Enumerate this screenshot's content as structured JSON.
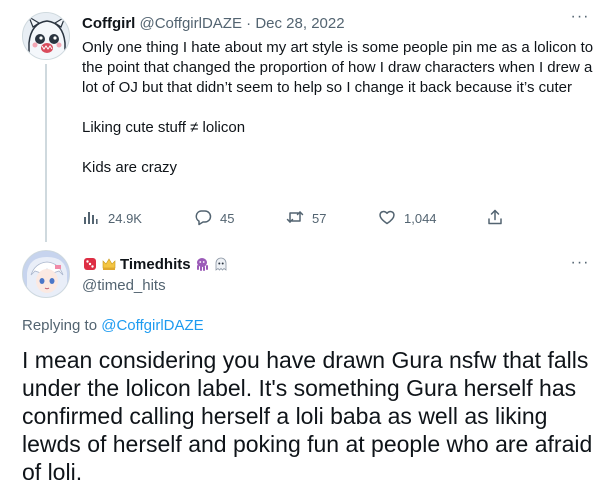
{
  "tweet": {
    "author_name": "Coffgirl",
    "author_handle": "@CoffgirlDAZE",
    "separator": " · ",
    "date": "Dec 28, 2022",
    "more_label": "···",
    "paragraphs": [
      "Only one thing I hate about my art style is some people pin me as a lolicon to the point that changed the proportion of how I draw characters when I drew a lot of OJ but that didn’t seem to help so I change it back because it’s cuter",
      "Liking cute stuff ≠ lolicon",
      "Kids are crazy"
    ],
    "metrics": {
      "views": "24.9K",
      "replies": "45",
      "retweets": "57",
      "likes": "1,044"
    },
    "icons": [
      "analytics-icon",
      "reply-icon",
      "retweet-icon",
      "like-icon",
      "share-icon"
    ]
  },
  "reply": {
    "author_name": "Timedhits",
    "author_handle": "@timed_hits",
    "name_emojis": [
      "dice-icon",
      "crown-icon",
      "octopus-icon",
      "ghost-icon"
    ],
    "more_label": "···",
    "replying_prefix": "Replying to ",
    "replying_to": "@CoffgirlDAZE",
    "text": "I mean considering you have drawn Gura nsfw that falls under the lolicon label. It's something Gura herself has confirmed calling herself a loli baba as well as liking lewds of herself and poking fun at people who are afraid of loli."
  },
  "colors": {
    "text": "#0f1419",
    "secondary": "#536471",
    "link": "#1d9bf0",
    "divider": "#cfd9de"
  }
}
